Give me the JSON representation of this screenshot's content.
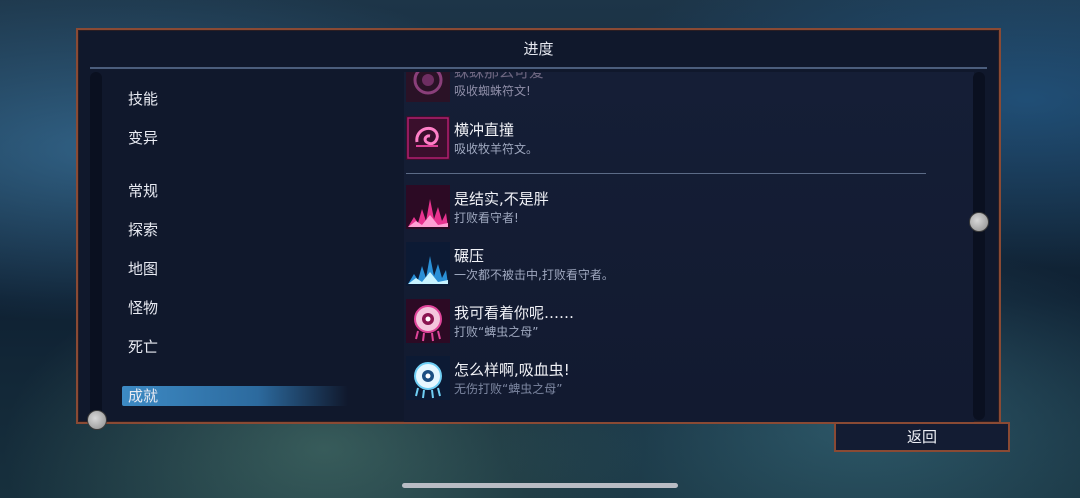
{
  "dialog": {
    "title": "进度"
  },
  "categories": [
    {
      "label": "技能"
    },
    {
      "label": "变异"
    },
    {
      "label": "常规"
    },
    {
      "label": "探索"
    },
    {
      "label": "地图"
    },
    {
      "label": "怪物"
    },
    {
      "label": "死亡"
    },
    {
      "label": "成就",
      "selected": true
    }
  ],
  "achievements": [
    {
      "name": "蛛蛛那么可爱",
      "desc": "吸收蜘蛛符文!",
      "icon": "spider-rune-icon",
      "partially_visible": true
    },
    {
      "name": "横冲直撞",
      "desc": "吸收牧羊符文。",
      "icon": "ram-rune-icon"
    },
    {
      "name": "是结实,不是胖",
      "desc": "打败看守者!",
      "icon": "watcher-pink-icon"
    },
    {
      "name": "碾压",
      "desc": "一次都不被击中,打败看守者。",
      "icon": "watcher-blue-icon"
    },
    {
      "name": "我可看着你呢……",
      "desc": "打败“蜱虫之母”",
      "icon": "tick-mother-pink-icon"
    },
    {
      "name": "怎么样啊,吸血虫!",
      "desc": "无伤打败“蜱虫之母”",
      "icon": "tick-mother-blue-icon"
    }
  ],
  "footer": {
    "back_label": "返回"
  },
  "colors": {
    "panel_border": "#8a4a34",
    "selected_item": "#3d8ac4",
    "panel_bg": "#10182c"
  }
}
